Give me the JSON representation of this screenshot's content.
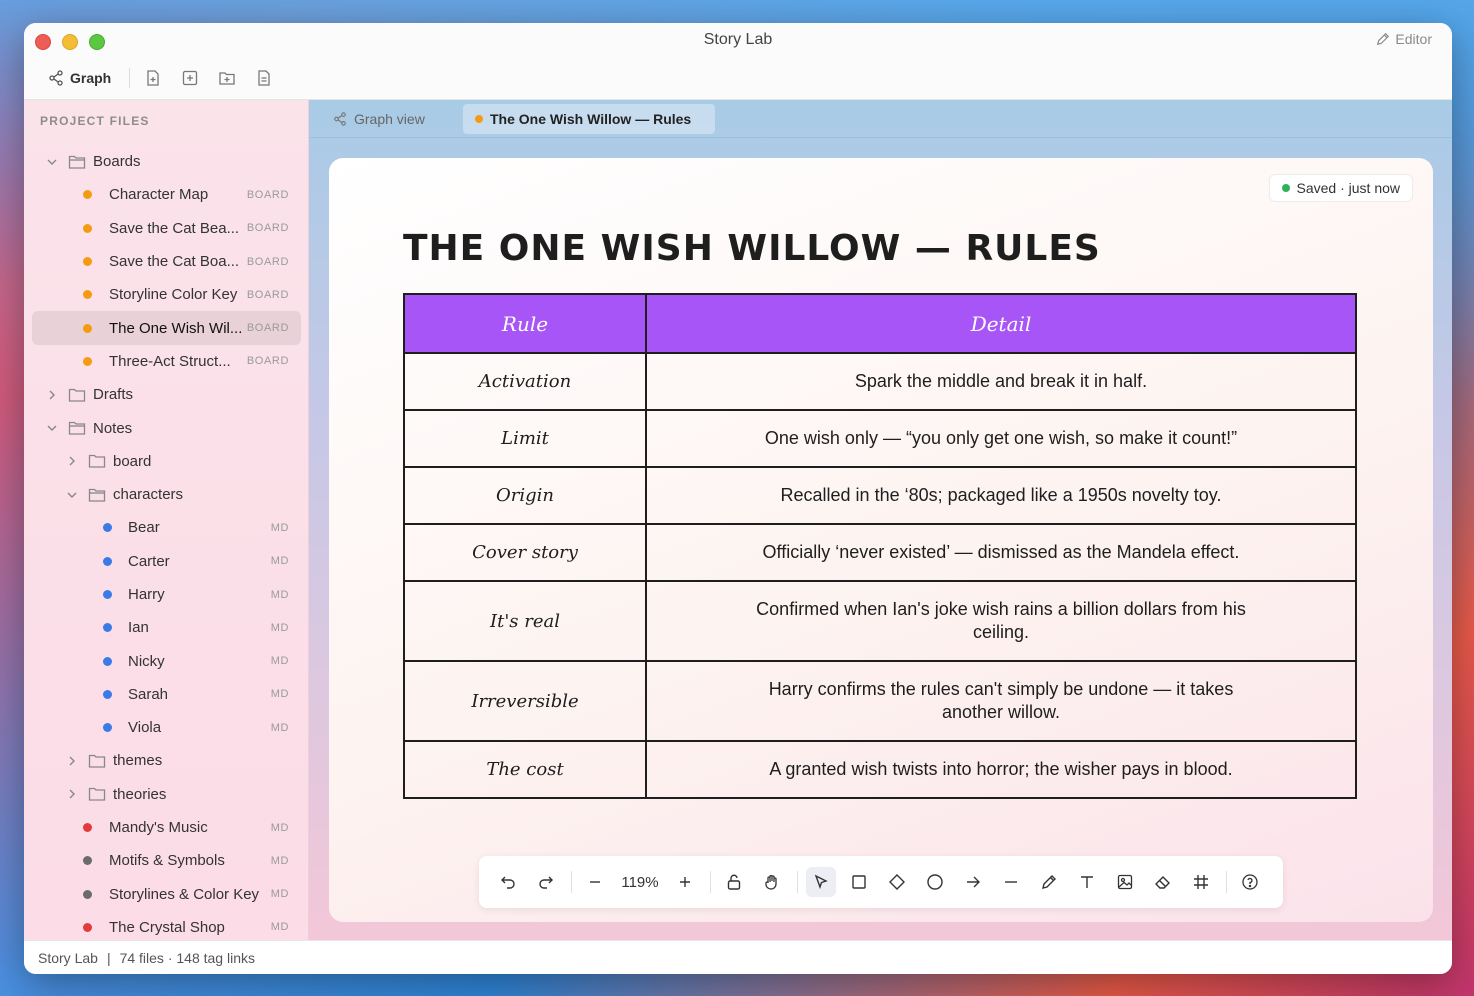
{
  "window": {
    "title": "Story Lab",
    "editor_label": "Editor"
  },
  "toolbar": {
    "graph_label": "Graph"
  },
  "sidebar": {
    "header": "PROJECT FILES",
    "boards_folder": "Boards",
    "boards": [
      {
        "label": "Character Map",
        "badge": "BOARD"
      },
      {
        "label": "Save the Cat Bea...",
        "badge": "BOARD"
      },
      {
        "label": "Save the Cat Boa...",
        "badge": "BOARD"
      },
      {
        "label": "Storyline Color Key",
        "badge": "BOARD"
      },
      {
        "label": "The One Wish Wil...",
        "badge": "BOARD"
      },
      {
        "label": "Three-Act Struct...",
        "badge": "BOARD"
      }
    ],
    "drafts_folder": "Drafts",
    "notes_folder": "Notes",
    "board_subfolder": "board",
    "characters_subfolder": "characters",
    "characters": [
      {
        "label": "Bear",
        "badge": "MD"
      },
      {
        "label": "Carter",
        "badge": "MD"
      },
      {
        "label": "Harry",
        "badge": "MD"
      },
      {
        "label": "Ian",
        "badge": "MD"
      },
      {
        "label": "Nicky",
        "badge": "MD"
      },
      {
        "label": "Sarah",
        "badge": "MD"
      },
      {
        "label": "Viola",
        "badge": "MD"
      }
    ],
    "themes_subfolder": "themes",
    "theories_subfolder": "theories",
    "notes": [
      {
        "label": "Mandy's Music",
        "badge": "MD",
        "color": "#e23b3b"
      },
      {
        "label": "Motifs & Symbols",
        "badge": "MD",
        "color": "#6b6b6b"
      },
      {
        "label": "Storylines & Color Key",
        "badge": "MD",
        "color": "#6b6b6b"
      },
      {
        "label": "The Crystal Shop",
        "badge": "MD",
        "color": "#e23b3b"
      }
    ],
    "colors": {
      "board_dot": "#f39c12",
      "character_dot": "#3b7be8"
    }
  },
  "tabs": {
    "graph": "Graph view",
    "active": "The One Wish Willow — Rules"
  },
  "canvas": {
    "saved": "Saved · just now",
    "title": "THE ONE WISH WILLOW — RULES",
    "table": {
      "headers": [
        "Rule",
        "Detail"
      ],
      "rows": [
        [
          "Activation",
          "Spark the middle and break it in half."
        ],
        [
          "Limit",
          "One wish only — “you only get one wish, so make it count!”"
        ],
        [
          "Origin",
          "Recalled in the ‘80s; packaged like a 1950s novelty toy."
        ],
        [
          "Cover story",
          "Officially ‘never existed’ — dismissed as the Mandela effect."
        ],
        [
          "It's real",
          "Confirmed when Ian's joke wish rains a billion dollars from his ceiling."
        ],
        [
          "Irreversible",
          "Harry confirms the rules can't simply be undone — it takes another willow."
        ],
        [
          "The cost",
          "A granted wish twists into horror; the wisher pays in blood."
        ]
      ],
      "header_color": "#a855f7"
    },
    "zoom": "119%"
  },
  "status": {
    "app": "Story Lab",
    "sep": "|",
    "info": "74 files · 148 tag links"
  }
}
